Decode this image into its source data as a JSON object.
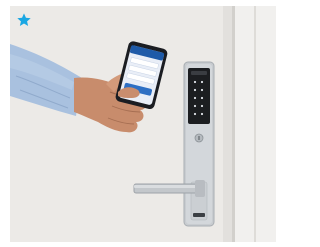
{
  "image": {
    "subject": "smart-door-lock",
    "icons": [
      "star-icon"
    ],
    "colors": {
      "star": "#1aa7e3",
      "door": "#ecebe9",
      "lock_body": "#c9cdd1",
      "keypad": "#1c1e21",
      "sleeve": "#a8c0de",
      "skin": "#c98d6e",
      "phone_screen": "#e8eef8"
    }
  }
}
